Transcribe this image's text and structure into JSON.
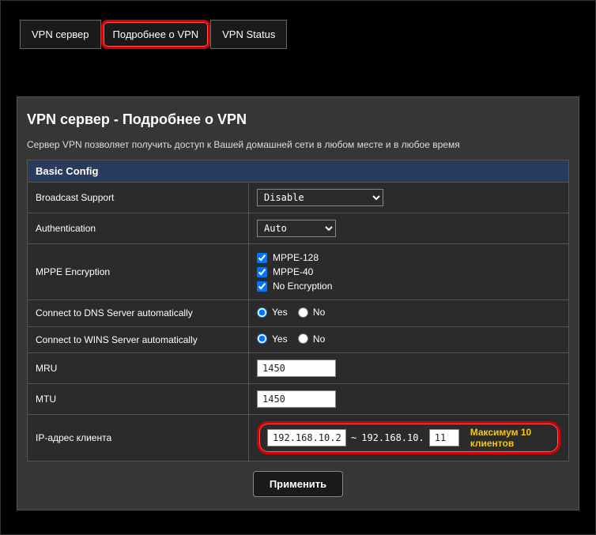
{
  "tabs": {
    "t0": "VPN сервер",
    "t1": "Подробнее о VPN",
    "t2": "VPN Status"
  },
  "page_title": "VPN сервер - Подробнее о VPN",
  "page_desc": "Сервер VPN позволяет получить доступ к Вашей домашней сети в любом месте и в любое время",
  "section_header": "Basic Config",
  "rows": {
    "broadcast": {
      "label": "Broadcast Support",
      "value": "Disable"
    },
    "auth": {
      "label": "Authentication",
      "value": "Auto"
    },
    "mppe": {
      "label": "MPPE Encryption",
      "opt0": "MPPE-128",
      "opt1": "MPPE-40",
      "opt2": "No Encryption"
    },
    "dns": {
      "label": "Connect to DNS Server automatically",
      "yes": "Yes",
      "no": "No"
    },
    "wins": {
      "label": "Connect to WINS Server automatically",
      "yes": "Yes",
      "no": "No"
    },
    "mru": {
      "label": "MRU",
      "value": "1450"
    },
    "mtu": {
      "label": "MTU",
      "value": "1450"
    },
    "ip": {
      "label": "IP-адрес клиента",
      "start": "192.168.10.2",
      "sep": "~",
      "prefix": "192.168.10.",
      "end": "11",
      "max": "Максимум 10 клиентов"
    }
  },
  "apply": "Применить"
}
